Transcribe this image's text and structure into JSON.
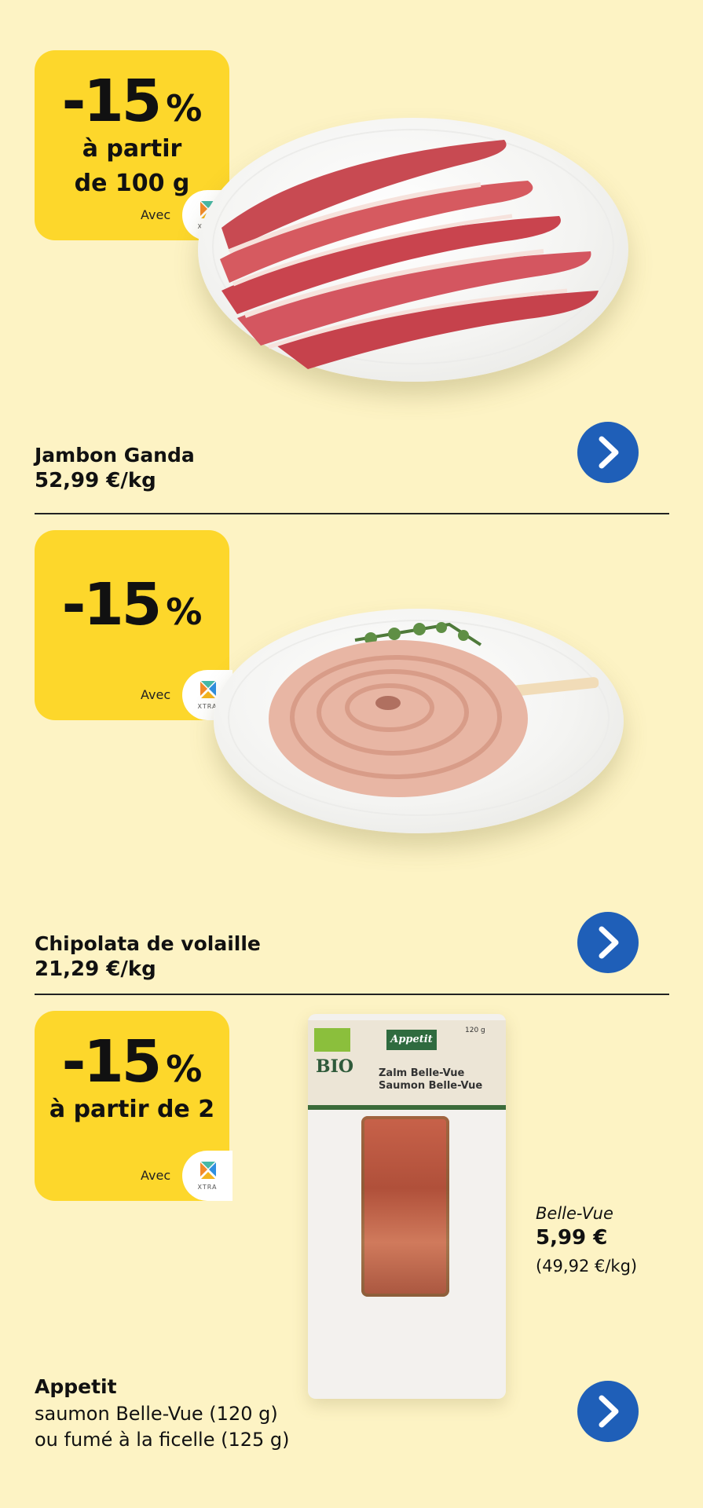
{
  "products": [
    {
      "name": "Jambon Ganda",
      "price": "52,99 €/kg",
      "badge": {
        "discount": "-15",
        "unit": "%",
        "line1": "à partir",
        "line2": "de 100 g",
        "avec": "Avec",
        "program": "XTRA"
      }
    },
    {
      "name": "Chipolata de volaille",
      "price": "21,29 €/kg",
      "badge": {
        "discount": "-15",
        "unit": "%",
        "avec": "Avec",
        "program": "XTRA"
      }
    },
    {
      "name": "Appetit",
      "description_line1": "saumon Belle-Vue (120 g)",
      "description_line2": "ou fumé à la ficelle (125 g)",
      "badge": {
        "discount": "-15",
        "unit": "%",
        "line1": "à partir de 2",
        "avec": "Avec",
        "program": "XTRA"
      },
      "variant": "Belle-Vue",
      "variant_price": "5,99 €",
      "variant_unit_price": "(49,92 €/kg)",
      "package": {
        "brand": "Appetit",
        "bio": "BIO",
        "line1": "Zalm Belle-Vue",
        "line2": "Saumon Belle-Vue",
        "weight": "120 g"
      }
    }
  ],
  "icons": {
    "next": "chevron-right-icon",
    "program_logo": "xtra-logo-icon"
  },
  "colors": {
    "background": "#fdf3c4",
    "badge": "#fdd72b",
    "button": "#1f5fb8"
  }
}
